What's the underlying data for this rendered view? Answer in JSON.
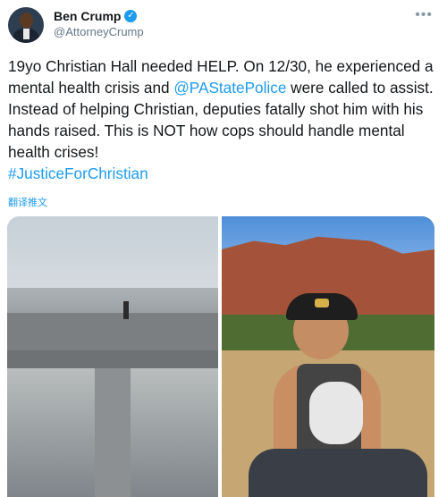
{
  "tweet": {
    "author_name": "Ben Crump",
    "author_handle": "@AttorneyCrump",
    "more_icon": "more-horizontal-icon",
    "verified_icon": "verified-badge-icon",
    "text_part1": "19yo Christian Hall needed HELP. On 12/30, he experienced a mental health crisis and ",
    "mention": "@PAStatePolice",
    "text_part2": " were called to assist. Instead of helping Christian, deputies fatally shot him with his hands raised. This is NOT how cops should handle mental health crises!",
    "hashtag": "#JusticeForChristian",
    "translate": "翻译推文",
    "colors": {
      "link": "#1d9bf0",
      "text": "#14171a",
      "subtle": "#657786"
    }
  }
}
